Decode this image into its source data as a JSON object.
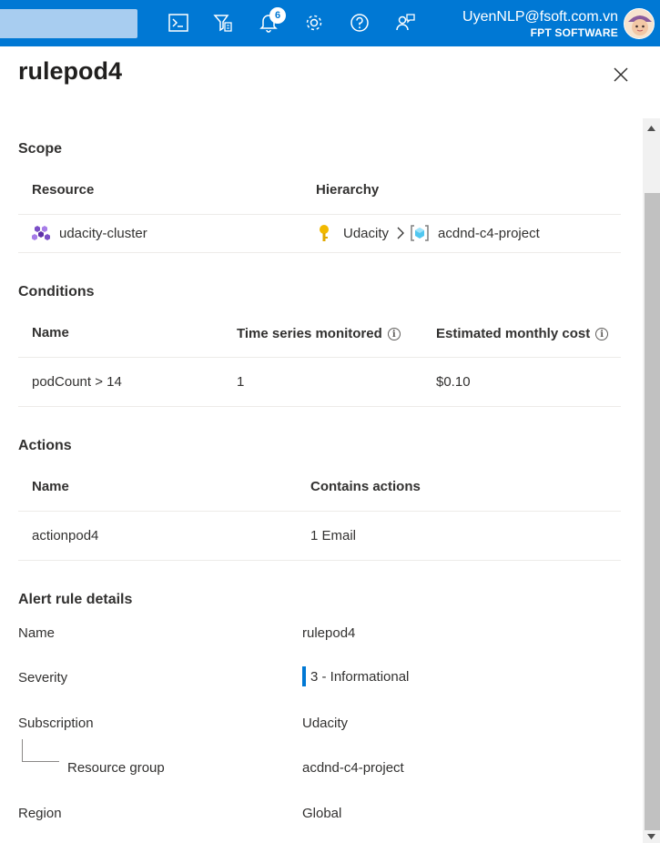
{
  "topbar": {
    "notification_count": "6",
    "icons": [
      "cloud-shell-icon",
      "directory-filter-icon",
      "bell-icon",
      "gear-icon",
      "help-icon",
      "feedback-icon"
    ],
    "account_email": "UyenNLP@fsoft.com.vn",
    "account_org": "FPT SOFTWARE",
    "accent_color": "#0078d4"
  },
  "panel": {
    "title": "rulepod4"
  },
  "scope": {
    "heading": "Scope",
    "columns": [
      "Resource",
      "Hierarchy"
    ],
    "resource": "udacity-cluster",
    "hierarchy": [
      "Udacity",
      "acdnd-c4-project"
    ]
  },
  "conditions": {
    "heading": "Conditions",
    "columns": [
      "Name",
      "Time series monitored",
      "Estimated monthly cost"
    ],
    "row": [
      "podCount > 14",
      "1",
      "$0.10"
    ]
  },
  "actions": {
    "heading": "Actions",
    "columns": [
      "Name",
      "Contains actions"
    ],
    "row": [
      "actionpod4",
      "1 Email"
    ]
  },
  "details": {
    "heading": "Alert rule details",
    "name_label": "Name",
    "name_value": "rulepod4",
    "severity_label": "Severity",
    "severity_value": "3 - Informational",
    "subscription_label": "Subscription",
    "subscription_value": "Udacity",
    "resource_group_label": "Resource group",
    "resource_group_value": "acdnd-c4-project",
    "region_label": "Region",
    "region_value": "Global"
  }
}
